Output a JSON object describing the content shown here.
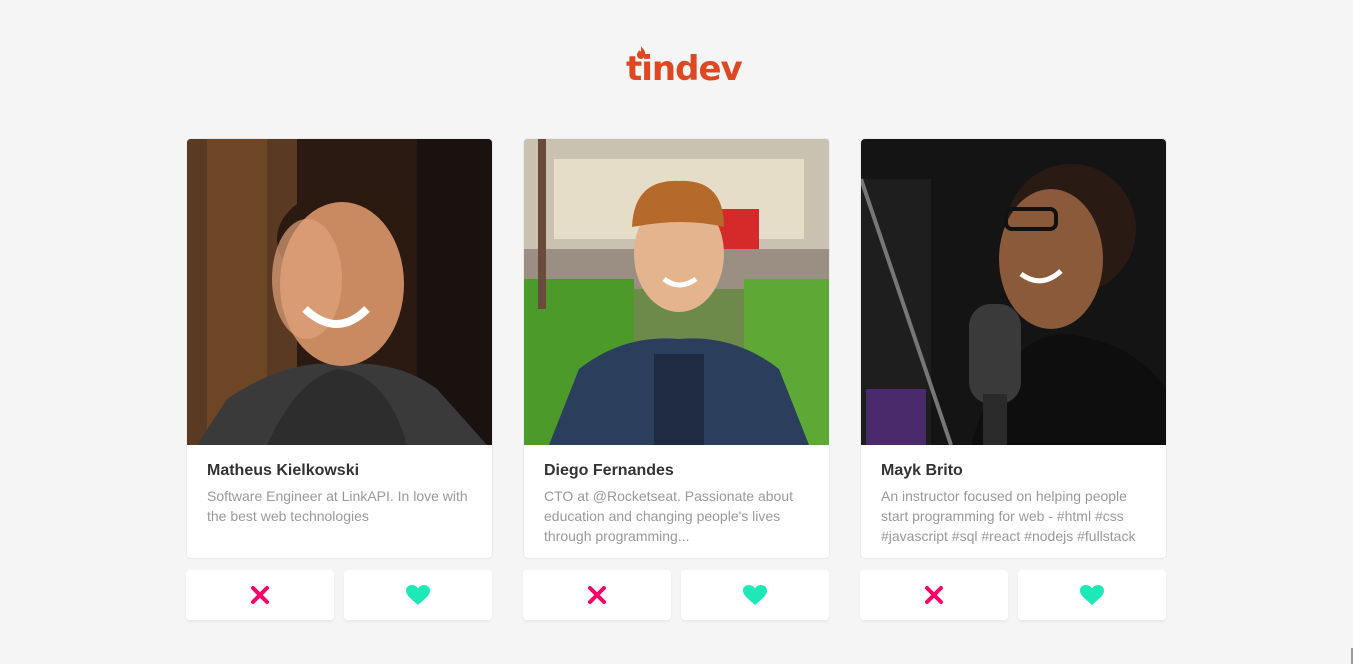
{
  "header": {
    "logo_text": "tindev"
  },
  "colors": {
    "brand": "#df4723",
    "dislike": "#ff0068",
    "like": "#1de9b6"
  },
  "cards": [
    {
      "name": "Matheus Kielkowski",
      "bio": "Software Engineer at LinkAPI. In love with the best web technologies",
      "dislike_icon": "close-x-icon",
      "like_icon": "heart-icon"
    },
    {
      "name": "Diego Fernandes",
      "bio": "CTO at @Rocketseat. Passionate about education and changing people's lives through programming...",
      "dislike_icon": "close-x-icon",
      "like_icon": "heart-icon"
    },
    {
      "name": "Mayk Brito",
      "bio": "An instructor focused on helping people start programming for web - #html #css #javascript #sql #react #nodejs #fullstack",
      "dislike_icon": "close-x-icon",
      "like_icon": "heart-icon"
    }
  ]
}
